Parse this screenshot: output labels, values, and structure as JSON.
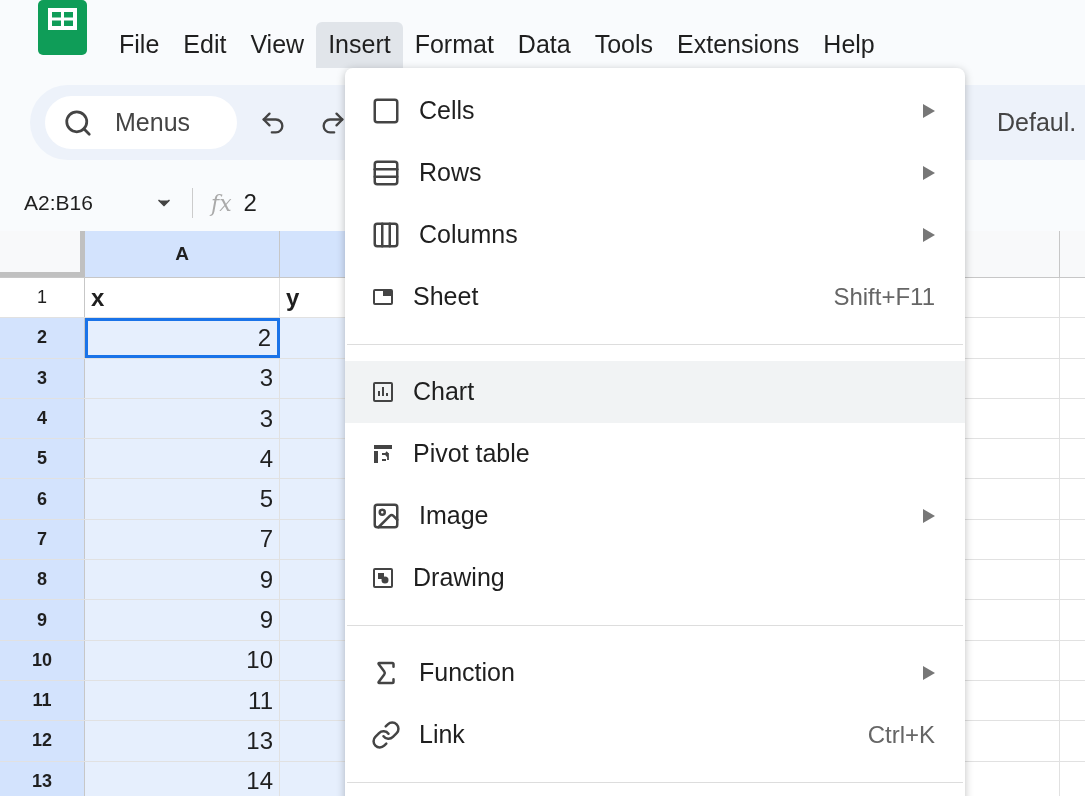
{
  "menubar": [
    {
      "label": "File",
      "selected": false
    },
    {
      "label": "Edit",
      "selected": false
    },
    {
      "label": "View",
      "selected": false
    },
    {
      "label": "Insert",
      "selected": true
    },
    {
      "label": "Format",
      "selected": false
    },
    {
      "label": "Data",
      "selected": false
    },
    {
      "label": "Tools",
      "selected": false
    },
    {
      "label": "Extensions",
      "selected": false
    },
    {
      "label": "Help",
      "selected": false
    }
  ],
  "toolbar": {
    "search": {
      "placeholder": "Menus"
    },
    "font": "Defaul."
  },
  "formula_bar": {
    "name_box": "A2:B16",
    "function_label": "fx",
    "formula": "2"
  },
  "sheet": {
    "columns": [
      {
        "label": "A",
        "selected": true
      }
    ],
    "rows": [
      {
        "number": "1",
        "selected": false,
        "active": false,
        "cells": [
          "x",
          "y"
        ]
      },
      {
        "number": "2",
        "selected": true,
        "active": true,
        "cells": [
          "2"
        ]
      },
      {
        "number": "3",
        "selected": true,
        "active": false,
        "cells": [
          "3"
        ]
      },
      {
        "number": "4",
        "selected": true,
        "active": false,
        "cells": [
          "3"
        ]
      },
      {
        "number": "5",
        "selected": true,
        "active": false,
        "cells": [
          "4"
        ]
      },
      {
        "number": "6",
        "selected": true,
        "active": false,
        "cells": [
          "5"
        ]
      },
      {
        "number": "7",
        "selected": true,
        "active": false,
        "cells": [
          "7"
        ]
      },
      {
        "number": "8",
        "selected": true,
        "active": false,
        "cells": [
          "9"
        ]
      },
      {
        "number": "9",
        "selected": true,
        "active": false,
        "cells": [
          "9"
        ]
      },
      {
        "number": "10",
        "selected": true,
        "active": false,
        "cells": [
          "10"
        ]
      },
      {
        "number": "11",
        "selected": true,
        "active": false,
        "cells": [
          "11"
        ]
      },
      {
        "number": "12",
        "selected": true,
        "active": false,
        "cells": [
          "13"
        ]
      },
      {
        "number": "13",
        "selected": true,
        "active": false,
        "cells": [
          "14"
        ]
      }
    ]
  },
  "insert_menu": [
    {
      "kind": "item",
      "label": "Cells",
      "submenu": true,
      "highlighted": false
    },
    {
      "kind": "item",
      "label": "Rows",
      "submenu": true,
      "highlighted": false
    },
    {
      "kind": "item",
      "label": "Columns",
      "submenu": true,
      "highlighted": false
    },
    {
      "kind": "item",
      "label": "Sheet",
      "shortcut": "Shift+F11",
      "submenu": false,
      "highlighted": false
    },
    {
      "kind": "divider"
    },
    {
      "kind": "item",
      "label": "Chart",
      "submenu": false,
      "highlighted": true
    },
    {
      "kind": "item",
      "label": "Pivot table",
      "submenu": false,
      "highlighted": false
    },
    {
      "kind": "item",
      "label": "Image",
      "submenu": true,
      "highlighted": false
    },
    {
      "kind": "item",
      "label": "Drawing",
      "submenu": false,
      "highlighted": false
    },
    {
      "kind": "divider"
    },
    {
      "kind": "item",
      "label": "Function",
      "submenu": true,
      "highlighted": false
    },
    {
      "kind": "item",
      "label": "Link",
      "shortcut": "Ctrl+K",
      "submenu": false,
      "highlighted": false
    },
    {
      "kind": "divider"
    }
  ]
}
